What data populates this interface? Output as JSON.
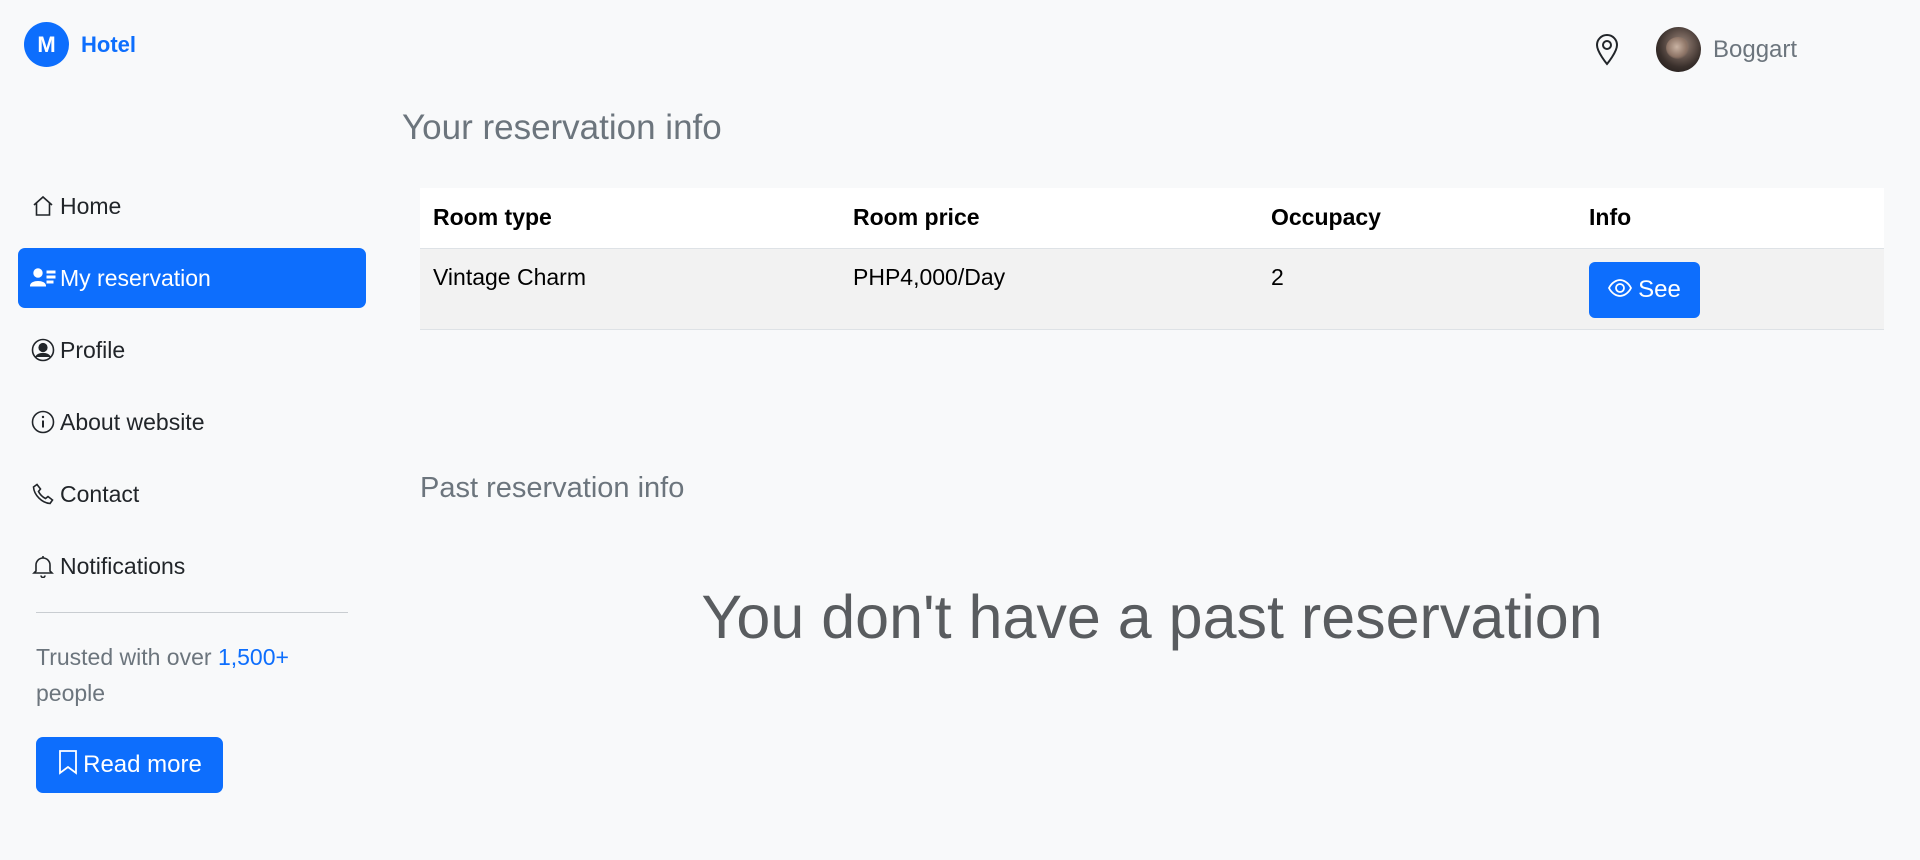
{
  "brand": {
    "logo_letter": "M",
    "name": "Hotel"
  },
  "header": {
    "location_icon": "map-pin-icon",
    "user_name": "Boggart"
  },
  "sidebar": {
    "items": [
      {
        "label": "Home",
        "icon": "house-icon",
        "active": false
      },
      {
        "label": "My reservation",
        "icon": "person-list-icon",
        "active": true
      },
      {
        "label": "Profile",
        "icon": "person-circle-icon",
        "active": false
      },
      {
        "label": "About website",
        "icon": "info-circle-icon",
        "active": false
      },
      {
        "label": "Contact",
        "icon": "phone-icon",
        "active": false
      },
      {
        "label": "Notifications",
        "icon": "bell-icon",
        "active": false
      }
    ],
    "trusted_prefix": "Trusted with over ",
    "trusted_count": "1,500+",
    "trusted_suffix": "people",
    "read_more_label": "Read more"
  },
  "main": {
    "title": "Your reservation info",
    "table": {
      "headers": [
        "Room type",
        "Room price",
        "Occupacy",
        "Info"
      ],
      "rows": [
        {
          "room_type": "Vintage Charm",
          "room_price": "PHP4,000/Day",
          "occupancy": "2",
          "action_label": "See"
        }
      ]
    },
    "past_title": "Past reservation info",
    "past_empty_message": "You don't have a past reservation"
  },
  "colors": {
    "accent": "#0d6efd",
    "muted_text": "#6c757d",
    "background": "#f8f9fa"
  }
}
